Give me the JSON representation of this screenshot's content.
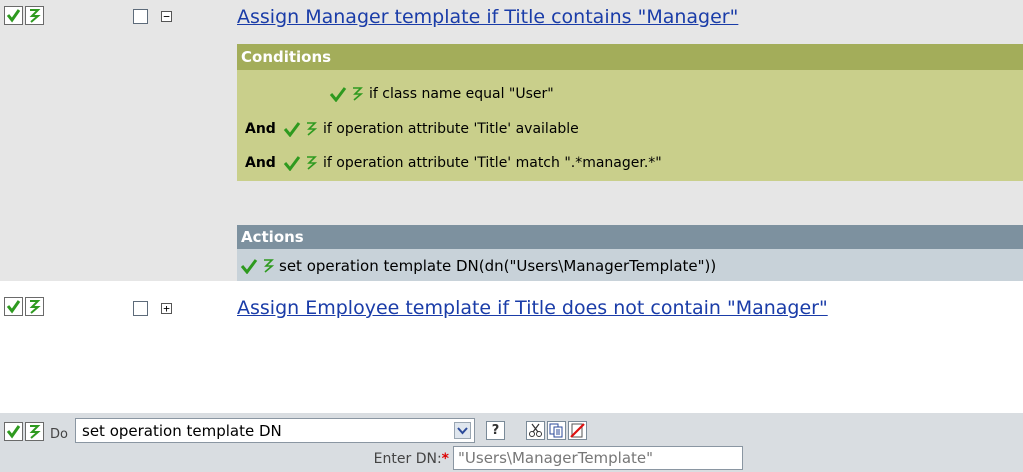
{
  "rules": [
    {
      "title": "Assign Manager template if Title contains \"Manager\"",
      "expander": "−",
      "conditions_header": "Conditions",
      "conditions": [
        {
          "prefix": "",
          "text": "if class name equal \"User\""
        },
        {
          "prefix": "And",
          "text": "if operation attribute 'Title' available"
        },
        {
          "prefix": "And",
          "text": "if operation attribute 'Title' match \".*manager.*\""
        }
      ],
      "actions_header": "Actions",
      "actions": [
        "set operation template DN(dn(\"Users\\ManagerTemplate\"))"
      ]
    },
    {
      "title": "Assign Employee template if Title does not contain \"Manager\"",
      "expander": "+"
    }
  ],
  "editor": {
    "do_label": "Do",
    "action_select_value": "set operation template DN",
    "help_icon": "?",
    "field_label": "Enter DN:",
    "required_marker": "*",
    "dn_value": "\"Users\\ManagerTemplate\""
  },
  "colors": {
    "check_green": "#2e9a1f",
    "link_blue": "#1a3ca8",
    "rule_bg": "#e6e6e6",
    "conditions_header_bg": "#a3ad5a",
    "conditions_body_bg": "#c9cf8b",
    "actions_header_bg": "#7d919f",
    "actions_body_bg": "#c8d2d9",
    "editor_bg": "#d9dde1"
  },
  "icons": [
    "checkmark-icon",
    "trace-icon",
    "help-icon",
    "cut-icon",
    "copy-icon",
    "delete-icon"
  ]
}
